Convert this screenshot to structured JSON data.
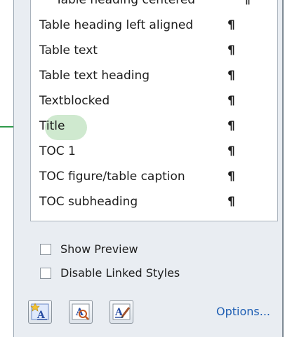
{
  "styles_list": {
    "clipped_top_label": "Table heading centered",
    "clipped_top_mark": "¶",
    "items": [
      {
        "label": "Table heading left aligned",
        "mark": "¶"
      },
      {
        "label": "Table text",
        "mark": "¶"
      },
      {
        "label": "Table text heading",
        "mark": "¶"
      },
      {
        "label": "Textblocked",
        "mark": "¶"
      },
      {
        "label": "Title",
        "mark": "¶"
      },
      {
        "label": "TOC 1",
        "mark": "¶"
      },
      {
        "label": "TOC figure/table caption",
        "mark": "¶"
      },
      {
        "label": "TOC subheading",
        "mark": "¶"
      }
    ],
    "highlight_color": "#cfe9cf"
  },
  "options": {
    "show_preview_label": "Show Preview",
    "disable_linked_label": "Disable Linked Styles",
    "show_preview_checked": false,
    "disable_linked_checked": false
  },
  "toolbar": {
    "new_style_icon": "new-style-icon",
    "style_inspector_icon": "style-inspector-icon",
    "manage_styles_icon": "manage-styles-icon",
    "options_link": "Options..."
  },
  "colors": {
    "callout": "#2e9a4a",
    "link": "#1f5fb4",
    "pane_bg": "#e9edf2"
  }
}
